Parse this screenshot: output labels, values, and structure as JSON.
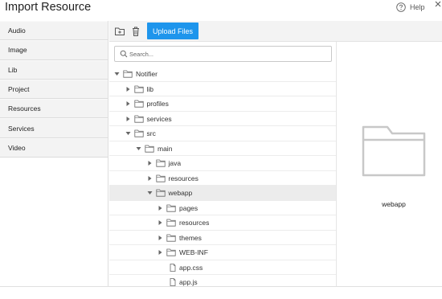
{
  "dialog": {
    "title": "Import Resource",
    "help_label": "Help"
  },
  "sidebar": {
    "items": [
      {
        "label": "Audio"
      },
      {
        "label": "Image"
      },
      {
        "label": "Lib"
      },
      {
        "label": "Project"
      },
      {
        "label": "Resources"
      },
      {
        "label": "Services"
      },
      {
        "label": "Video"
      }
    ]
  },
  "toolbar": {
    "upload_label": "Upload Files",
    "new_folder_icon": "folder-add-icon",
    "delete_icon": "trash-icon"
  },
  "search": {
    "placeholder": "Search..."
  },
  "tree": [
    {
      "name": "Notifier",
      "depth": 0,
      "type": "folder",
      "expanded": true
    },
    {
      "name": "lib",
      "depth": 1,
      "type": "folder",
      "expanded": false
    },
    {
      "name": "profiles",
      "depth": 1,
      "type": "folder",
      "expanded": false
    },
    {
      "name": "services",
      "depth": 1,
      "type": "folder",
      "expanded": false
    },
    {
      "name": "src",
      "depth": 1,
      "type": "folder",
      "expanded": true
    },
    {
      "name": "main",
      "depth": 2,
      "type": "folder",
      "expanded": true
    },
    {
      "name": "java",
      "depth": 3,
      "type": "folder",
      "expanded": false
    },
    {
      "name": "resources",
      "depth": 3,
      "type": "folder",
      "expanded": false
    },
    {
      "name": "webapp",
      "depth": 3,
      "type": "folder",
      "expanded": true,
      "selected": true
    },
    {
      "name": "pages",
      "depth": 4,
      "type": "folder",
      "expanded": false
    },
    {
      "name": "resources",
      "depth": 4,
      "type": "folder",
      "expanded": false
    },
    {
      "name": "themes",
      "depth": 4,
      "type": "folder",
      "expanded": false
    },
    {
      "name": "WEB-INF",
      "depth": 4,
      "type": "folder",
      "expanded": false
    },
    {
      "name": "app.css",
      "depth": 4,
      "type": "file"
    },
    {
      "name": "app.js",
      "depth": 4,
      "type": "file"
    }
  ],
  "preview": {
    "name": "webapp",
    "icon": "folder-icon"
  },
  "colors": {
    "accent": "#1e95ec",
    "sidebar_bg": "#f3f3f3",
    "selected_row": "#ececec"
  }
}
